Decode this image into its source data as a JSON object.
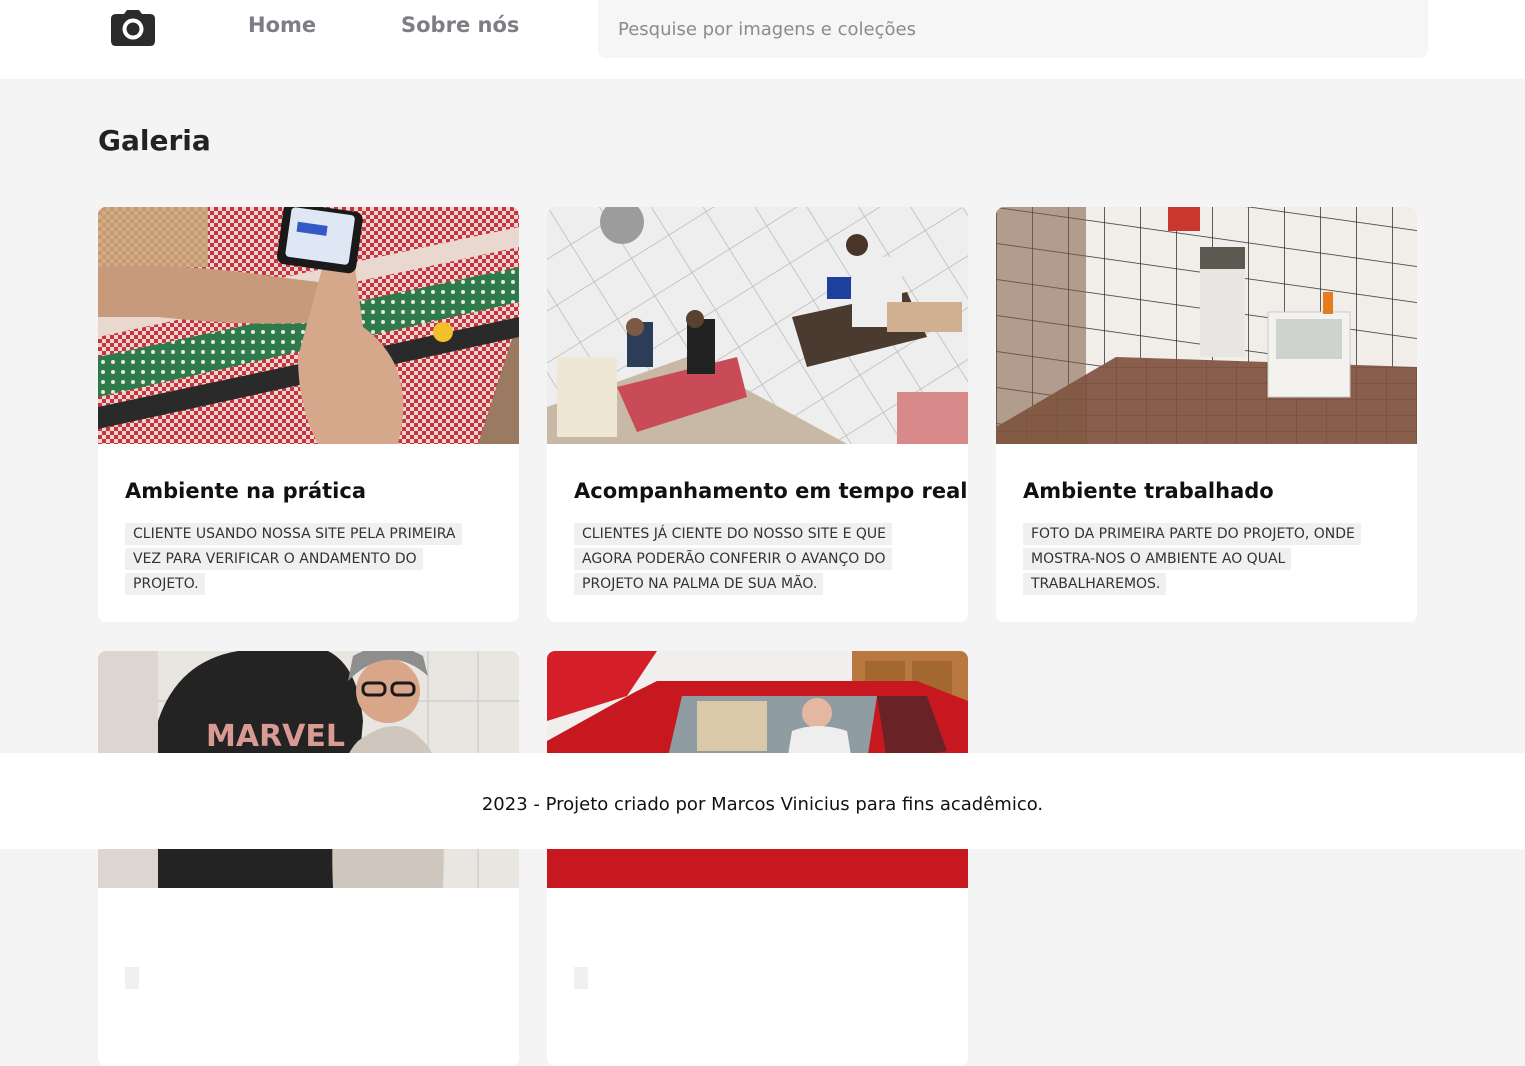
{
  "header": {
    "logo_icon": "camera-icon",
    "nav": [
      {
        "label": "Home"
      },
      {
        "label": "Sobre nós"
      }
    ],
    "search": {
      "placeholder": "Pesquise por imagens e coleções",
      "value": ""
    }
  },
  "main": {
    "title": "Galeria",
    "cards": [
      {
        "title": "Ambiente na prática",
        "description": "Cliente usando nossa site pela primeira vez para verificar o andamento do projeto.",
        "image": "photo-hand-phone-tablecloth"
      },
      {
        "title": "Acompanhamento em tempo real",
        "description": "Clientes já ciente do nosso site e que agora poderão conferir o avanço do projeto na palma de sua mão.",
        "image": "photo-restaurant-people-tables"
      },
      {
        "title": "Ambiente trabalhado",
        "description": "Foto da primeira parte do projeto, onde mostra-nos o ambiente ao qual trabalharemos.",
        "image": "photo-kitchen-tiled-room"
      },
      {
        "title": "",
        "description": "",
        "image": "photo-two-people-marvel-shirt"
      },
      {
        "title": "",
        "description": "",
        "image": "photo-man-in-red-car"
      }
    ]
  },
  "footer": {
    "text": "2023 - Projeto criado por Marcos Vinicius para fins acadêmico."
  },
  "colors": {
    "background": "#f4f4f4",
    "surface": "#ffffff",
    "nav_text": "#7d7d86",
    "search_bg": "#f6f6f6"
  }
}
